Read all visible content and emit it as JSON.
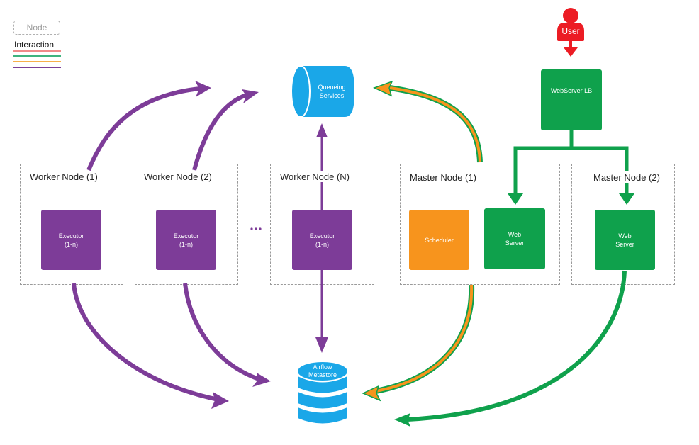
{
  "legend": {
    "node_label": "Node",
    "interaction_label": "Interaction",
    "interaction_colors": [
      "#f08a8a",
      "#3fb37f",
      "#f7b04a",
      "#7b3f98"
    ]
  },
  "colors": {
    "purple": "#7d3c98",
    "blue": "#1aa7e8",
    "green": "#0fa14c",
    "orange": "#f7941d",
    "red": "#ec1c24",
    "dashed_border": "#9a9a9a"
  },
  "user": {
    "label": "User"
  },
  "load_balancer": {
    "label": "WebServer LB"
  },
  "queue": {
    "label_line1": "Queueing",
    "label_line2": "Services"
  },
  "metastore": {
    "label_line1": "Airflow",
    "label_line2": "Metastore"
  },
  "ellipsis": "...",
  "worker_nodes": [
    {
      "title": "Worker Node (1)",
      "component": {
        "line1": "Executor",
        "line2": "(1-n)"
      }
    },
    {
      "title": "Worker Node (2)",
      "component": {
        "line1": "Executor",
        "line2": "(1-n)"
      }
    },
    {
      "title": "Worker Node (N)",
      "component": {
        "line1": "Executor",
        "line2": "(1-n)"
      }
    }
  ],
  "master_nodes": [
    {
      "title": "Master Node (1)",
      "scheduler": {
        "line1": "Scheduler"
      },
      "webserver": {
        "line1": "Web",
        "line2": "Server"
      }
    },
    {
      "title": "Master Node (2)",
      "webserver": {
        "line1": "Web",
        "line2": "Server"
      }
    }
  ]
}
